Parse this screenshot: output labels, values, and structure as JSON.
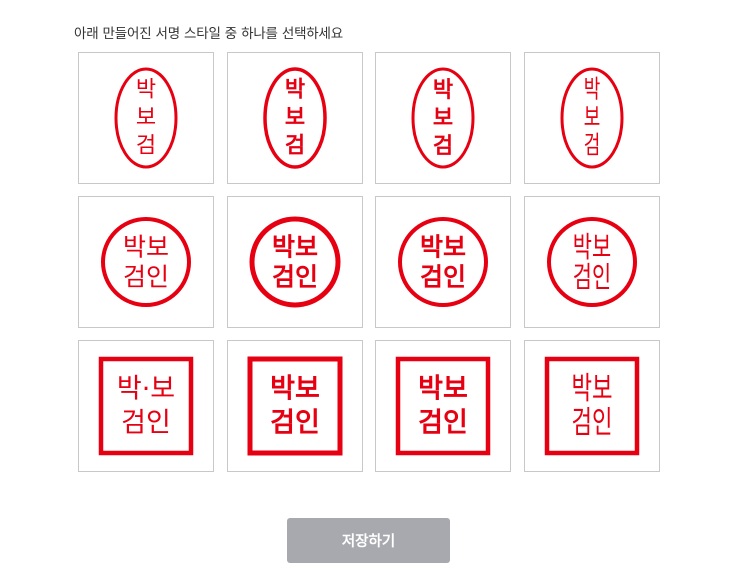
{
  "instruction": "아래 만들어진 서명 스타일 중 하나를 선택하세요",
  "stamp_color": "#e60012",
  "stamp_text": {
    "short_chars": [
      "박",
      "보",
      "검"
    ],
    "long_lines": [
      "박보",
      "검인"
    ],
    "long_lines_dot": [
      "박·보",
      "검인"
    ]
  },
  "styles": [
    {
      "shape": "oval",
      "font": "sans"
    },
    {
      "shape": "oval",
      "font": "bold"
    },
    {
      "shape": "oval",
      "font": "brush"
    },
    {
      "shape": "oval",
      "font": "seal"
    },
    {
      "shape": "circle",
      "font": "sans"
    },
    {
      "shape": "circle",
      "font": "bold"
    },
    {
      "shape": "circle",
      "font": "brush"
    },
    {
      "shape": "circle",
      "font": "seal"
    },
    {
      "shape": "square",
      "font": "sans"
    },
    {
      "shape": "square",
      "font": "bold"
    },
    {
      "shape": "square",
      "font": "brush"
    },
    {
      "shape": "square",
      "font": "seal"
    }
  ],
  "save_button": {
    "label": "저장하기",
    "enabled": false,
    "color": "#a7a9ae"
  }
}
